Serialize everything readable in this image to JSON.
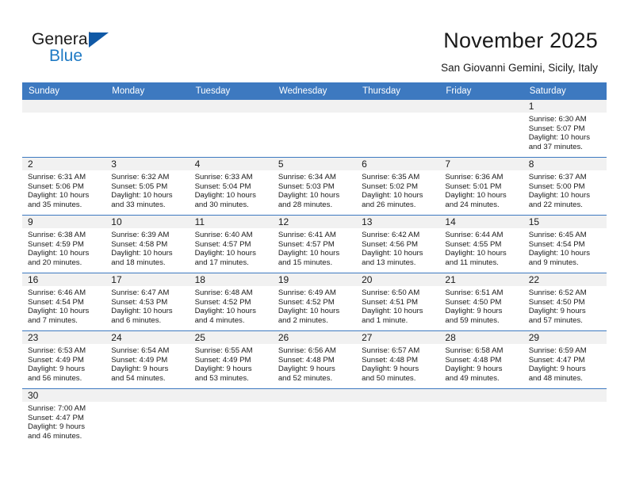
{
  "brand": {
    "logo_line1": "General",
    "logo_line2": "Blue",
    "accent_color": "#1f7ac4",
    "triangle_color": "#1059a6"
  },
  "header": {
    "title": "November 2025",
    "subtitle": "San Giovanni Gemini, Sicily, Italy"
  },
  "calendar": {
    "header_bg": "#3d79c0",
    "daynum_bg": "#f1f1f1",
    "weekday_headers": [
      "Sunday",
      "Monday",
      "Tuesday",
      "Wednesday",
      "Thursday",
      "Friday",
      "Saturday"
    ],
    "weeks": [
      [
        {
          "day": "",
          "empty": true
        },
        {
          "day": "",
          "empty": true
        },
        {
          "day": "",
          "empty": true
        },
        {
          "day": "",
          "empty": true
        },
        {
          "day": "",
          "empty": true
        },
        {
          "day": "",
          "empty": true
        },
        {
          "day": "1",
          "sunrise": "Sunrise: 6:30 AM",
          "sunset": "Sunset: 5:07 PM",
          "daylight1": "Daylight: 10 hours",
          "daylight2": "and 37 minutes."
        }
      ],
      [
        {
          "day": "2",
          "sunrise": "Sunrise: 6:31 AM",
          "sunset": "Sunset: 5:06 PM",
          "daylight1": "Daylight: 10 hours",
          "daylight2": "and 35 minutes."
        },
        {
          "day": "3",
          "sunrise": "Sunrise: 6:32 AM",
          "sunset": "Sunset: 5:05 PM",
          "daylight1": "Daylight: 10 hours",
          "daylight2": "and 33 minutes."
        },
        {
          "day": "4",
          "sunrise": "Sunrise: 6:33 AM",
          "sunset": "Sunset: 5:04 PM",
          "daylight1": "Daylight: 10 hours",
          "daylight2": "and 30 minutes."
        },
        {
          "day": "5",
          "sunrise": "Sunrise: 6:34 AM",
          "sunset": "Sunset: 5:03 PM",
          "daylight1": "Daylight: 10 hours",
          "daylight2": "and 28 minutes."
        },
        {
          "day": "6",
          "sunrise": "Sunrise: 6:35 AM",
          "sunset": "Sunset: 5:02 PM",
          "daylight1": "Daylight: 10 hours",
          "daylight2": "and 26 minutes."
        },
        {
          "day": "7",
          "sunrise": "Sunrise: 6:36 AM",
          "sunset": "Sunset: 5:01 PM",
          "daylight1": "Daylight: 10 hours",
          "daylight2": "and 24 minutes."
        },
        {
          "day": "8",
          "sunrise": "Sunrise: 6:37 AM",
          "sunset": "Sunset: 5:00 PM",
          "daylight1": "Daylight: 10 hours",
          "daylight2": "and 22 minutes."
        }
      ],
      [
        {
          "day": "9",
          "sunrise": "Sunrise: 6:38 AM",
          "sunset": "Sunset: 4:59 PM",
          "daylight1": "Daylight: 10 hours",
          "daylight2": "and 20 minutes."
        },
        {
          "day": "10",
          "sunrise": "Sunrise: 6:39 AM",
          "sunset": "Sunset: 4:58 PM",
          "daylight1": "Daylight: 10 hours",
          "daylight2": "and 18 minutes."
        },
        {
          "day": "11",
          "sunrise": "Sunrise: 6:40 AM",
          "sunset": "Sunset: 4:57 PM",
          "daylight1": "Daylight: 10 hours",
          "daylight2": "and 17 minutes."
        },
        {
          "day": "12",
          "sunrise": "Sunrise: 6:41 AM",
          "sunset": "Sunset: 4:57 PM",
          "daylight1": "Daylight: 10 hours",
          "daylight2": "and 15 minutes."
        },
        {
          "day": "13",
          "sunrise": "Sunrise: 6:42 AM",
          "sunset": "Sunset: 4:56 PM",
          "daylight1": "Daylight: 10 hours",
          "daylight2": "and 13 minutes."
        },
        {
          "day": "14",
          "sunrise": "Sunrise: 6:44 AM",
          "sunset": "Sunset: 4:55 PM",
          "daylight1": "Daylight: 10 hours",
          "daylight2": "and 11 minutes."
        },
        {
          "day": "15",
          "sunrise": "Sunrise: 6:45 AM",
          "sunset": "Sunset: 4:54 PM",
          "daylight1": "Daylight: 10 hours",
          "daylight2": "and 9 minutes."
        }
      ],
      [
        {
          "day": "16",
          "sunrise": "Sunrise: 6:46 AM",
          "sunset": "Sunset: 4:54 PM",
          "daylight1": "Daylight: 10 hours",
          "daylight2": "and 7 minutes."
        },
        {
          "day": "17",
          "sunrise": "Sunrise: 6:47 AM",
          "sunset": "Sunset: 4:53 PM",
          "daylight1": "Daylight: 10 hours",
          "daylight2": "and 6 minutes."
        },
        {
          "day": "18",
          "sunrise": "Sunrise: 6:48 AM",
          "sunset": "Sunset: 4:52 PM",
          "daylight1": "Daylight: 10 hours",
          "daylight2": "and 4 minutes."
        },
        {
          "day": "19",
          "sunrise": "Sunrise: 6:49 AM",
          "sunset": "Sunset: 4:52 PM",
          "daylight1": "Daylight: 10 hours",
          "daylight2": "and 2 minutes."
        },
        {
          "day": "20",
          "sunrise": "Sunrise: 6:50 AM",
          "sunset": "Sunset: 4:51 PM",
          "daylight1": "Daylight: 10 hours",
          "daylight2": "and 1 minute."
        },
        {
          "day": "21",
          "sunrise": "Sunrise: 6:51 AM",
          "sunset": "Sunset: 4:50 PM",
          "daylight1": "Daylight: 9 hours",
          "daylight2": "and 59 minutes."
        },
        {
          "day": "22",
          "sunrise": "Sunrise: 6:52 AM",
          "sunset": "Sunset: 4:50 PM",
          "daylight1": "Daylight: 9 hours",
          "daylight2": "and 57 minutes."
        }
      ],
      [
        {
          "day": "23",
          "sunrise": "Sunrise: 6:53 AM",
          "sunset": "Sunset: 4:49 PM",
          "daylight1": "Daylight: 9 hours",
          "daylight2": "and 56 minutes."
        },
        {
          "day": "24",
          "sunrise": "Sunrise: 6:54 AM",
          "sunset": "Sunset: 4:49 PM",
          "daylight1": "Daylight: 9 hours",
          "daylight2": "and 54 minutes."
        },
        {
          "day": "25",
          "sunrise": "Sunrise: 6:55 AM",
          "sunset": "Sunset: 4:49 PM",
          "daylight1": "Daylight: 9 hours",
          "daylight2": "and 53 minutes."
        },
        {
          "day": "26",
          "sunrise": "Sunrise: 6:56 AM",
          "sunset": "Sunset: 4:48 PM",
          "daylight1": "Daylight: 9 hours",
          "daylight2": "and 52 minutes."
        },
        {
          "day": "27",
          "sunrise": "Sunrise: 6:57 AM",
          "sunset": "Sunset: 4:48 PM",
          "daylight1": "Daylight: 9 hours",
          "daylight2": "and 50 minutes."
        },
        {
          "day": "28",
          "sunrise": "Sunrise: 6:58 AM",
          "sunset": "Sunset: 4:48 PM",
          "daylight1": "Daylight: 9 hours",
          "daylight2": "and 49 minutes."
        },
        {
          "day": "29",
          "sunrise": "Sunrise: 6:59 AM",
          "sunset": "Sunset: 4:47 PM",
          "daylight1": "Daylight: 9 hours",
          "daylight2": "and 48 minutes."
        }
      ],
      [
        {
          "day": "30",
          "sunrise": "Sunrise: 7:00 AM",
          "sunset": "Sunset: 4:47 PM",
          "daylight1": "Daylight: 9 hours",
          "daylight2": "and 46 minutes."
        },
        {
          "day": "",
          "empty": true
        },
        {
          "day": "",
          "empty": true
        },
        {
          "day": "",
          "empty": true
        },
        {
          "day": "",
          "empty": true
        },
        {
          "day": "",
          "empty": true
        },
        {
          "day": "",
          "empty": true
        }
      ]
    ]
  }
}
